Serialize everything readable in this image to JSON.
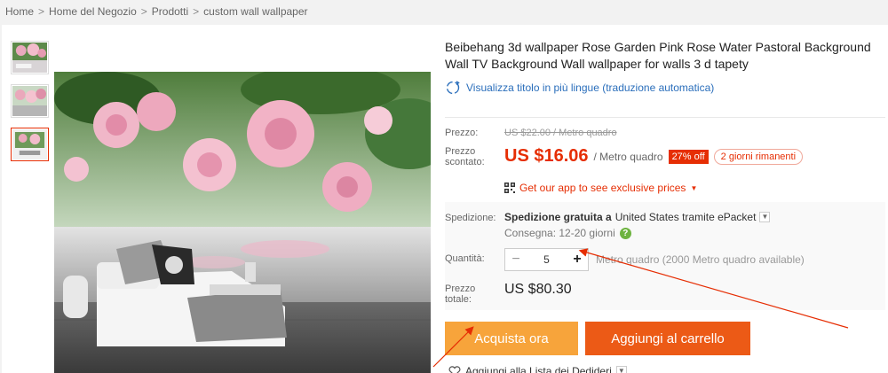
{
  "breadcrumb": [
    "Home",
    "Home del Negozio",
    "Prodotti",
    "custom wall wallpaper"
  ],
  "breadcrumb_sep": ">",
  "product": {
    "title": "Beibehang 3d wallpaper Rose Garden Pink Rose Water Pastoral Background Wall TV Background Wall wallpaper for walls 3 d tapety",
    "translate_link": "Visualizza titolo in più lingue (traduzione automatica)"
  },
  "pricing": {
    "price_label": "Prezzo:",
    "old_price": "US $22.00 / Metro quadro",
    "discount_label": "Prezzo scontato:",
    "new_price": "US $16.06",
    "unit": "/ Metro quadro",
    "discount_badge": "27% off",
    "days_left": "2 giorni rimanenti",
    "app_promo": "Get our app to see exclusive prices"
  },
  "shipping": {
    "label": "Spedizione:",
    "free_text": "Spedizione gratuita a",
    "destination": "United States tramite ePacket",
    "delivery": "Consegna: 12-20 giorni"
  },
  "quantity": {
    "label": "Quantità:",
    "value": "5",
    "minus": "−",
    "plus": "+",
    "available": "Metro quadro (2000 Metro quadro available)"
  },
  "total": {
    "label": "Prezzo totale:",
    "value": "US $80.30"
  },
  "actions": {
    "buy_now": "Acquista ora",
    "add_to_cart": "Aggiungi al carrello",
    "wishlist": "Aggiungi alla Lista dei Dedideri"
  },
  "colors": {
    "accent": "#e62e04",
    "buy_button": "#f7a43b",
    "cart_button": "#ec5a16",
    "link": "#2a6ebb"
  },
  "icons": {
    "translate": "globe-refresh-icon",
    "qr": "qr-code-icon",
    "help": "question-icon",
    "wishlist": "heart-plus-icon"
  }
}
